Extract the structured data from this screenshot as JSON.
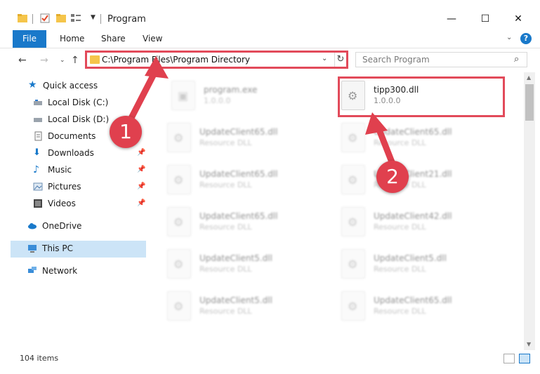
{
  "window": {
    "title": "Program",
    "minimize": "—",
    "maximize": "☐",
    "close": "✕"
  },
  "ribbon": {
    "file": "File",
    "home": "Home",
    "share": "Share",
    "view": "View",
    "help": "?"
  },
  "address": {
    "path": "C:\\Program Files\\Program Directory",
    "search_placeholder": "Search Program"
  },
  "nav": {
    "items": [
      {
        "label": "Quick access"
      },
      {
        "label": "Local Disk (C:)"
      },
      {
        "label": "Local Disk (D:)"
      },
      {
        "label": "Documents"
      },
      {
        "label": "Downloads"
      },
      {
        "label": "Music"
      },
      {
        "label": "Pictures"
      },
      {
        "label": "Videos"
      },
      {
        "label": "OneDrive"
      },
      {
        "label": "This PC"
      },
      {
        "label": "Network"
      }
    ]
  },
  "files": [
    {
      "name": "program.exe",
      "sub": "1.0.0.0"
    },
    {
      "name": "tipp300.dll",
      "sub": "1.0.0.0"
    },
    {
      "name": "UpdateClient65.dll",
      "sub": "Resource DLL"
    },
    {
      "name": "UpdateClient65.dll",
      "sub": "Resource DLL"
    },
    {
      "name": "UpdateClient65.dll",
      "sub": "Resource DLL"
    },
    {
      "name": "UpdateClient21.dll",
      "sub": "Resource DLL"
    },
    {
      "name": "UpdateClient65.dll",
      "sub": "Resource DLL"
    },
    {
      "name": "UpdateClient42.dll",
      "sub": "Resource DLL"
    },
    {
      "name": "UpdateClient5.dll",
      "sub": "Resource DLL"
    },
    {
      "name": "UpdateClient5.dll",
      "sub": "Resource DLL"
    },
    {
      "name": "UpdateClient5.dll",
      "sub": "Resource DLL"
    },
    {
      "name": "UpdateClient65.dll",
      "sub": "Resource DLL"
    }
  ],
  "status": {
    "count": "104 items"
  },
  "annotations": {
    "step1": "1",
    "step2": "2",
    "color": "#e0404e"
  },
  "colors": {
    "accent": "#1979ca",
    "selection": "#cce4f7",
    "highlight": "#e24a5a"
  }
}
